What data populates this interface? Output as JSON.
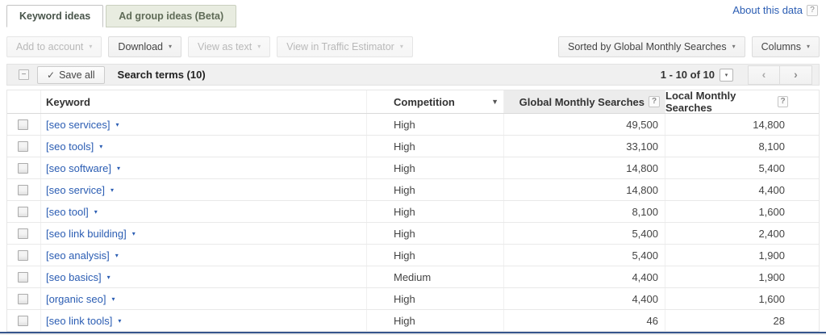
{
  "tabs": [
    {
      "label": "Keyword ideas"
    },
    {
      "label": "Ad group ideas (Beta)"
    }
  ],
  "header": {
    "about_link": "About this data",
    "help_icon": "?"
  },
  "toolbar": {
    "add_to_account": "Add to account",
    "download": "Download",
    "view_as_text": "View as text",
    "view_in_traffic_estimator": "View in Traffic Estimator",
    "sorted_by": "Sorted by Global Monthly Searches",
    "columns": "Columns",
    "caret": "▾"
  },
  "subtoolbar": {
    "collapse_icon": "−",
    "check_icon": "✓",
    "save_all": "Save all",
    "title": "Search terms (10)",
    "range": "1 - 10 of 10",
    "range_caret": "▾",
    "prev": "‹",
    "next": "›"
  },
  "table": {
    "headers": {
      "keyword": "Keyword",
      "competition": "Competition",
      "global": "Global Monthly Searches",
      "local": "Local Monthly Searches",
      "help_icon": "?",
      "sort_arrow": "▼"
    },
    "row_caret": "▾",
    "rows": [
      {
        "keyword": "[seo services]",
        "competition": "High",
        "global": "49,500",
        "local": "14,800"
      },
      {
        "keyword": "[seo tools]",
        "competition": "High",
        "global": "33,100",
        "local": "8,100"
      },
      {
        "keyword": "[seo software]",
        "competition": "High",
        "global": "14,800",
        "local": "5,400"
      },
      {
        "keyword": "[seo service]",
        "competition": "High",
        "global": "14,800",
        "local": "4,400"
      },
      {
        "keyword": "[seo tool]",
        "competition": "High",
        "global": "8,100",
        "local": "1,600"
      },
      {
        "keyword": "[seo link building]",
        "competition": "High",
        "global": "5,400",
        "local": "2,400"
      },
      {
        "keyword": "[seo analysis]",
        "competition": "High",
        "global": "5,400",
        "local": "1,900"
      },
      {
        "keyword": "[seo basics]",
        "competition": "Medium",
        "global": "4,400",
        "local": "1,900"
      },
      {
        "keyword": "[organic seo]",
        "competition": "High",
        "global": "4,400",
        "local": "1,600"
      },
      {
        "keyword": "[seo link tools]",
        "competition": "High",
        "global": "46",
        "local": "28"
      }
    ]
  },
  "colors": {
    "link_blue": "#2b5db3",
    "tab_inactive_bg": "#e8ece0",
    "sorted_header_bg": "#ececec",
    "footer_line": "#36558c"
  }
}
